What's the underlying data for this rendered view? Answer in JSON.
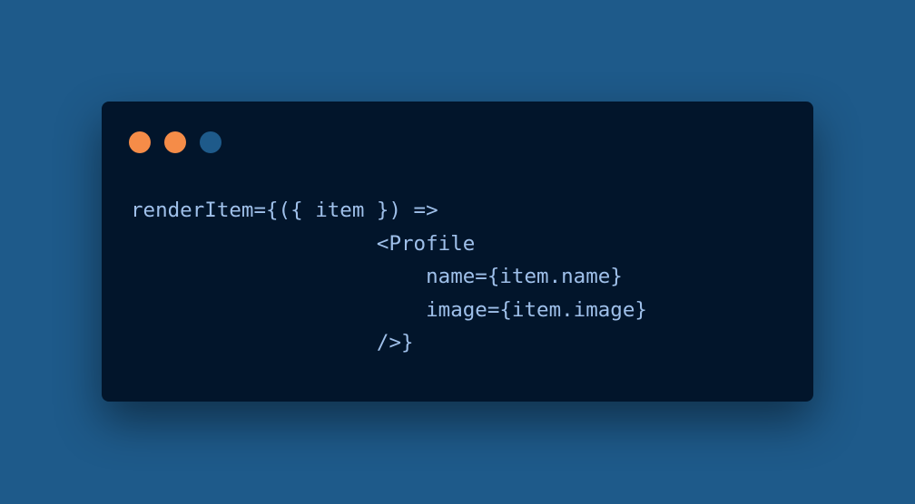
{
  "window": {
    "controls": [
      {
        "name": "close",
        "color": "#f58c48"
      },
      {
        "name": "minimize",
        "color": "#f58c48"
      },
      {
        "name": "maximize",
        "color": "#1e5a8a"
      }
    ]
  },
  "code": {
    "lines": [
      "renderItem={({ item }) =>",
      "                    <Profile",
      "                        name={item.name}",
      "                        image={item.image}",
      "                    />}"
    ]
  },
  "colors": {
    "background": "#1e5a8a",
    "window": "#02152b",
    "code_text": "#9fc0ea",
    "dot_orange": "#f58c48",
    "dot_blue": "#1e5a8a"
  }
}
